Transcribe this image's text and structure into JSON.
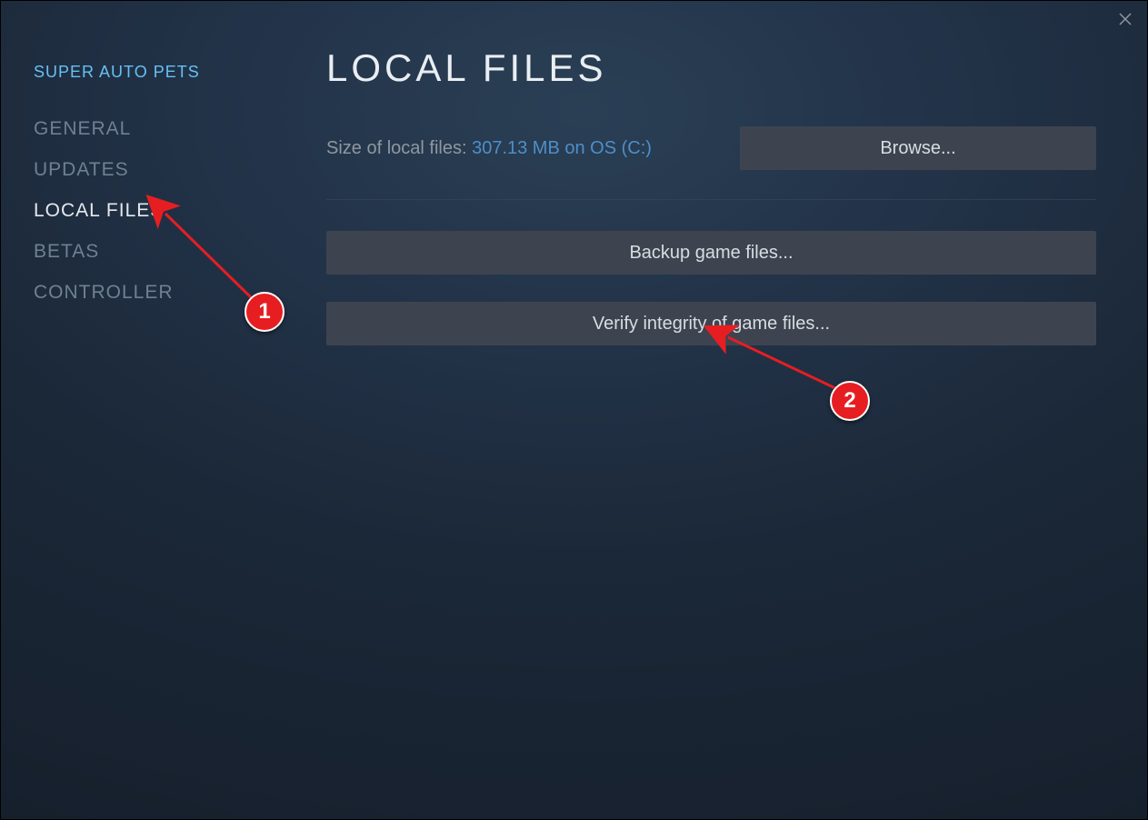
{
  "app_name": "SUPER AUTO PETS",
  "sidebar": {
    "items": [
      {
        "label": "GENERAL",
        "active": false
      },
      {
        "label": "UPDATES",
        "active": false
      },
      {
        "label": "LOCAL FILES",
        "active": true
      },
      {
        "label": "BETAS",
        "active": false
      },
      {
        "label": "CONTROLLER",
        "active": false
      }
    ]
  },
  "main": {
    "title": "LOCAL FILES",
    "size_label": "Size of local files: ",
    "size_value": "307.13 MB on OS (C:)",
    "browse_label": "Browse...",
    "backup_label": "Backup game files...",
    "verify_label": "Verify integrity of game files..."
  },
  "annotations": {
    "badge1": "1",
    "badge2": "2"
  }
}
